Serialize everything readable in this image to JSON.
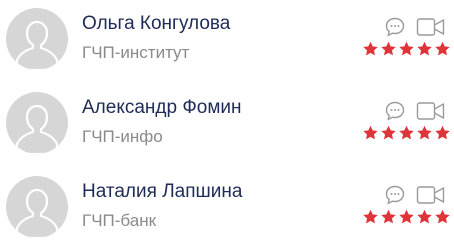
{
  "colors": {
    "name": "#1f2b57",
    "org": "#8a8a8a",
    "avatar_bg": "#d6d6d6",
    "avatar_figure": "#ffffff",
    "icon_stroke": "#9a9a9a",
    "star": "#e0333a"
  },
  "contacts": [
    {
      "name": "Ольга Конгулова",
      "org": "ГЧП-институт",
      "avatar_icon": "user-silhouette-icon",
      "actions": [
        "chat-bubble-icon",
        "video-camera-icon"
      ],
      "rating": 5
    },
    {
      "name": "Александр Фомин",
      "org": "ГЧП-инфо",
      "avatar_icon": "user-silhouette-icon",
      "actions": [
        "chat-bubble-icon",
        "video-camera-icon"
      ],
      "rating": 5
    },
    {
      "name": "Наталия Лапшина",
      "org": "ГЧП-банк",
      "avatar_icon": "user-silhouette-icon",
      "actions": [
        "chat-bubble-icon",
        "video-camera-icon"
      ],
      "rating": 5
    }
  ]
}
